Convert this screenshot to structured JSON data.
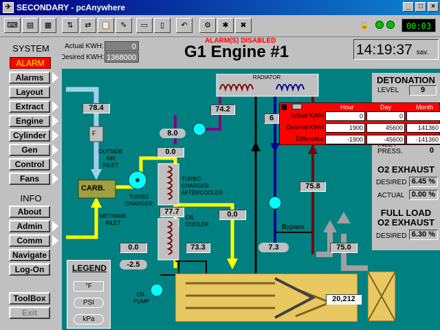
{
  "window": {
    "title": "SECONDARY - pcAnywhere",
    "app_icon": "pcanywhere-icon",
    "minimize": "_",
    "maximize": "□",
    "close": "×"
  },
  "toolbar": {
    "clock": "00:03"
  },
  "header": {
    "actual_kwh_label": "Actual KWH:",
    "actual_kwh": "0",
    "desired_kwh_label": "Desired KWH:",
    "desired_kwh": "1368000",
    "alarm_status": "ALARM(S) DISABLED",
    "title": "G1 Engine #1",
    "clock": "14:19:37",
    "clock_suffix": "sav."
  },
  "nav": {
    "system_label": "SYSTEM",
    "alarm_label": "ALARM",
    "items": [
      "Alarms",
      "Layout",
      "Extract",
      "Engine",
      "Cylinder",
      "Gen",
      "Control",
      "Fans"
    ],
    "info_label": "INFO",
    "info_items": [
      "About",
      "Admin",
      "Comm",
      "Navigate",
      "Log-On"
    ],
    "toolbox": "ToolBox",
    "exit": "Exit"
  },
  "diagram": {
    "radiator_label": "RADIATOR",
    "outside_air": [
      "OUTSIDE",
      "AIR",
      "INLET"
    ],
    "filter_label": "F",
    "carb_label": "CARB.",
    "turbo_label": [
      "TURBO",
      "CHARGER"
    ],
    "turbo_after_label": [
      "TURBO",
      "CHARGER",
      "AFTERCOOLER"
    ],
    "oil_cooler_label": [
      "OIL",
      "COOLER"
    ],
    "methane_label": [
      "METHANE",
      "INLET"
    ],
    "oil_pump_label": [
      "OIL",
      "PUMP"
    ],
    "bypass_label": "Bypass",
    "readings": {
      "air_temp": "78.4",
      "rad_in": "74.2",
      "r_8": "8.0",
      "turbo_out": "0.0",
      "after_cooler": "77.7",
      "m_right": "0.0",
      "oil_p": "0.0",
      "oil_t": "73.3",
      "neg": "-2.5",
      "r_6": "6",
      "r_758": "75.8",
      "r_73": "7.3",
      "r_750": "75.0",
      "hours": "20,212"
    }
  },
  "right_panel": {
    "detonation_title": "DETONATION",
    "level_label": "LEVEL",
    "level": "9",
    "inlet_press_label": [
      "INLET",
      "PRESS."
    ],
    "inlet_press": "0",
    "o2_title": "O2 EXHAUST",
    "desired_label": "DESIRED",
    "desired": "6.45 %",
    "actual_label": "ACTUAL",
    "actual": "0.00 %",
    "full_load_title": [
      "FULL LOAD",
      "O2 EXHAUST"
    ],
    "fl_desired_label": "DESIRED",
    "fl_desired": "6.30 %"
  },
  "popup": {
    "headers": [
      "Hour",
      "Day",
      "Month"
    ],
    "rows": [
      {
        "label": "Actual KWH",
        "values": [
          "0",
          "0",
          ""
        ]
      },
      {
        "label": "Desired KWH",
        "values": [
          "1900",
          "45600",
          "141360"
        ]
      },
      {
        "label": "Difference",
        "values": [
          "-1900",
          "-45600",
          "-141360"
        ]
      }
    ]
  },
  "legend": {
    "title": "LEGEND",
    "items": [
      "°F",
      "PSI",
      "kPa"
    ]
  },
  "colors": {
    "teal_bg": "#008080",
    "alarm_red": "#ff0000",
    "pipe_yellow": "#ffff00",
    "pipe_blue": "#0000a0",
    "pipe_purple": "#800080",
    "engine_gold": "#e8c860"
  }
}
